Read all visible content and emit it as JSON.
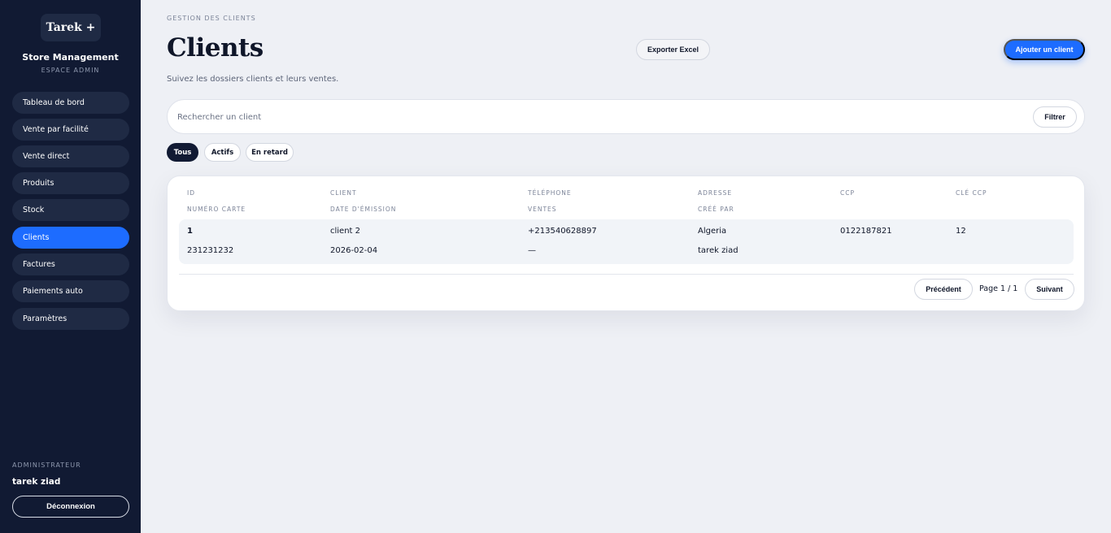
{
  "sidebar": {
    "brand_badge": "Tarek +",
    "brand_name": "Store Management",
    "brand_sub": "ESPACE ADMIN",
    "items": [
      {
        "label": "Tableau de bord"
      },
      {
        "label": "Vente par facilité"
      },
      {
        "label": "Vente direct"
      },
      {
        "label": "Produits"
      },
      {
        "label": "Stock"
      },
      {
        "label": "Clients",
        "active": true
      },
      {
        "label": "Factures"
      },
      {
        "label": "Paiements auto"
      },
      {
        "label": "Paramètres"
      }
    ],
    "admin_label": "ADMINISTRATEUR",
    "admin_name": "tarek ziad",
    "logout_label": "Déconnexion"
  },
  "header": {
    "breadcrumb": "GESTION DES CLIENTS",
    "title": "Clients",
    "subtitle": "Suivez les dossiers clients et leurs ventes.",
    "export_label": "Exporter Excel",
    "add_label": "Ajouter un client"
  },
  "search": {
    "placeholder": "Rechercher un client",
    "filter_label": "Filtrer"
  },
  "filters": [
    {
      "label": "Tous",
      "active": true
    },
    {
      "label": "Actifs"
    },
    {
      "label": "En retard"
    }
  ],
  "table": {
    "headers_top": [
      "ID",
      "CLIENT",
      "TÉLÉPHONE",
      "ADRESSE",
      "CCP",
      "CLÉ CCP"
    ],
    "headers_bottom": [
      "NUMÉRO CARTE",
      "DATE D'ÉMISSION",
      "VENTES",
      "CRÉÉ PAR"
    ],
    "rows": [
      {
        "id": "1",
        "client": "client 2",
        "phone": "+213540628897",
        "address": "Algeria",
        "ccp": "0122187821",
        "cle_ccp": "12",
        "card_number": "231231232",
        "issue_date": "2026-02-04",
        "sales": "—",
        "created_by": "tarek ziad"
      }
    ]
  },
  "pagination": {
    "prev_label": "Précédent",
    "info": "Page 1 / 1",
    "next_label": "Suivant"
  },
  "colors": {
    "accent": "#1d6cff",
    "sidebar_bg": "#111a33",
    "page_bg": "#eef0f5"
  }
}
